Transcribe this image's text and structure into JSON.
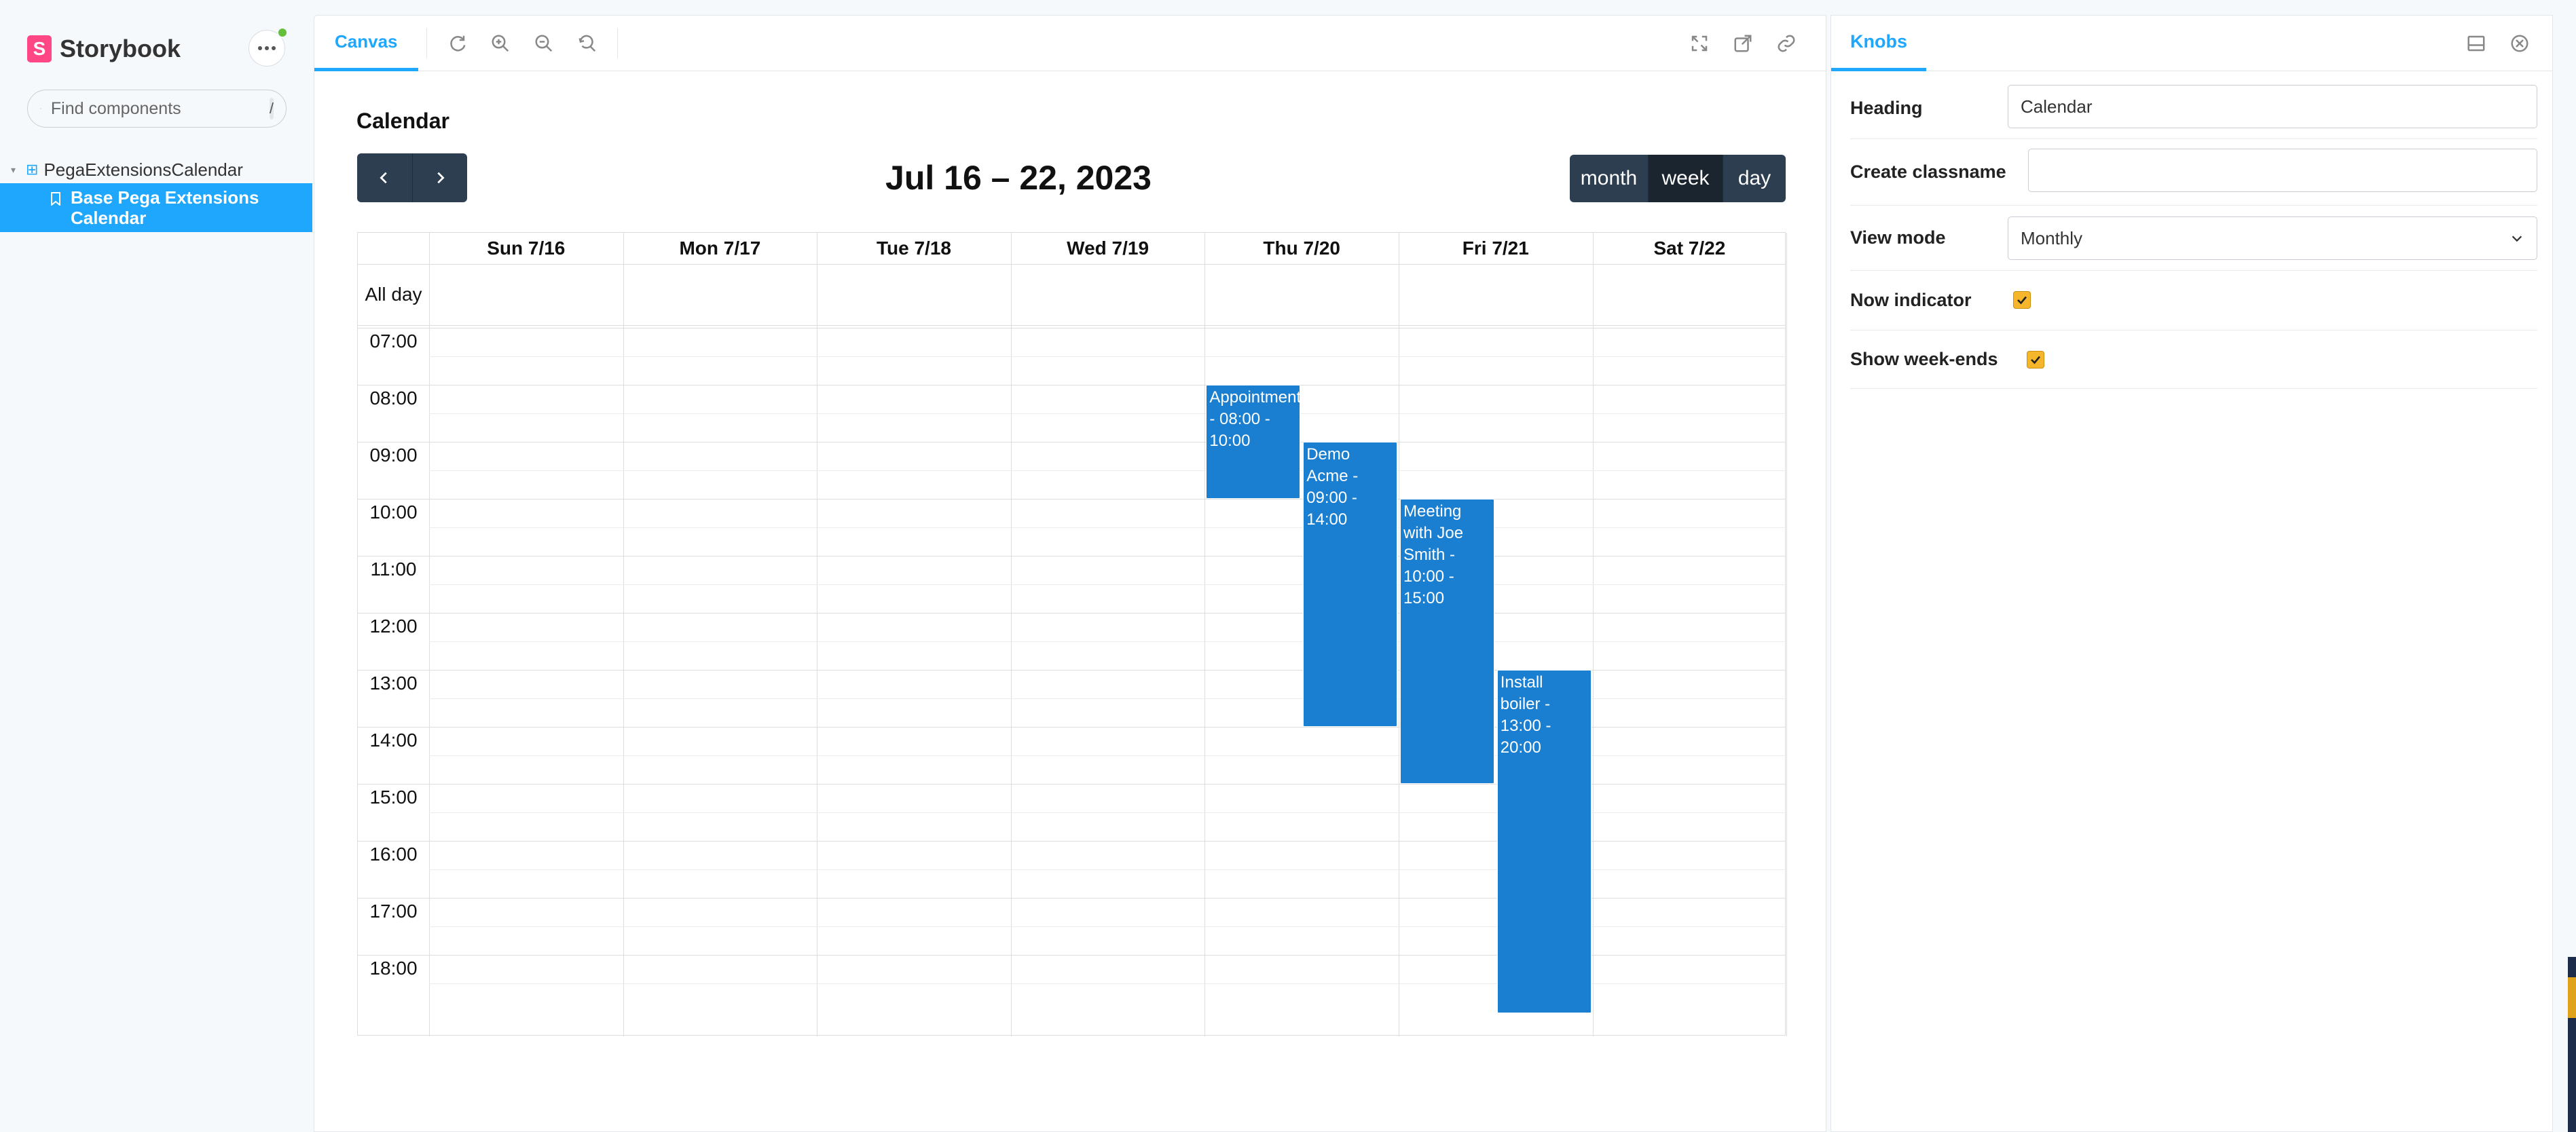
{
  "sidebar": {
    "brand": "Storybook",
    "search_placeholder": "Find components",
    "search_shortcut": "/",
    "group": "PegaExtensionsCalendar",
    "story": "Base Pega Extensions Calendar"
  },
  "preview": {
    "tab": "Canvas",
    "tools": [
      "reload-icon",
      "zoom-in-icon",
      "zoom-out-icon",
      "reset-zoom-icon"
    ],
    "right_tools": [
      "fullscreen-icon",
      "open-new-tab-icon",
      "copy-link-icon"
    ]
  },
  "calendar": {
    "heading": "Calendar",
    "title": "Jul 16 – 22, 2023",
    "views": [
      "month",
      "week",
      "day"
    ],
    "active_view": "week",
    "allday_label": "All day",
    "days": [
      "Sun 7/16",
      "Mon 7/17",
      "Tue 7/18",
      "Wed 7/19",
      "Thu 7/20",
      "Fri 7/21",
      "Sat 7/22"
    ],
    "times": [
      "07:00",
      "08:00",
      "09:00",
      "10:00",
      "11:00",
      "12:00",
      "13:00",
      "14:00",
      "15:00",
      "16:00",
      "17:00",
      "18:00"
    ],
    "events": [
      {
        "lines": [
          "Appointment",
          "- 08:00 -",
          "10:00"
        ],
        "day": 4,
        "start": 8,
        "end": 10,
        "column": 0,
        "columns": 2
      },
      {
        "lines": [
          "Demo",
          "Acme -",
          "09:00 -",
          "14:00"
        ],
        "day": 4,
        "start": 9,
        "end": 14,
        "column": 1,
        "columns": 2
      },
      {
        "lines": [
          "Meeting",
          "with Joe",
          "Smith -",
          "10:00 -",
          "15:00"
        ],
        "day": 5,
        "start": 10,
        "end": 15,
        "column": 0,
        "columns": 2
      },
      {
        "lines": [
          "Install",
          "boiler -",
          "13:00 -",
          "20:00"
        ],
        "day": 5,
        "start": 13,
        "end": 20,
        "column": 1,
        "columns": 2
      }
    ],
    "event_color": "#1a7fd0"
  },
  "knobs": {
    "tab": "Knobs",
    "heading_label": "Heading",
    "heading_value": "Calendar",
    "classname_label": "Create classname",
    "classname_value": "",
    "view_mode_label": "View mode",
    "view_mode_value": "Monthly",
    "now_indicator_label": "Now indicator",
    "now_indicator_checked": true,
    "weekends_label": "Show week-ends",
    "weekends_checked": true
  },
  "colors": {
    "accent": "#1ea7fd",
    "brand": "#ff4785",
    "nav_button": "#2c3e50",
    "checkbox": "#f5b62b"
  }
}
